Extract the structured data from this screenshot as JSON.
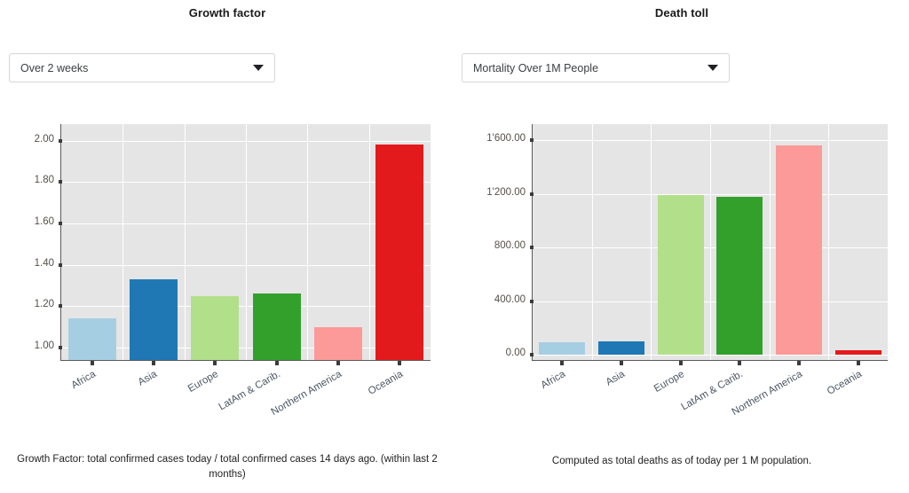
{
  "panels": [
    {
      "title": "Growth factor",
      "selector": {
        "value": "Over 2 weeks",
        "icon": "chevron-down-icon"
      },
      "caption": "Growth Factor: total confirmed cases today / total confirmed cases 14 days ago. (within last 2 months)",
      "chart_data": {
        "type": "bar",
        "title": "Growth factor",
        "xlabel": "",
        "ylabel": "",
        "categories": [
          "Africa",
          "Asia",
          "Europe",
          "LatAm & Carib.",
          "Northern America",
          "Oceania"
        ],
        "values": [
          1.14,
          1.33,
          1.25,
          1.26,
          1.1,
          1.98
        ],
        "colors": [
          "#a6cee3",
          "#1f78b4",
          "#b2df8a",
          "#33a02c",
          "#fb9a99",
          "#e31a1c"
        ],
        "ylim": [
          0.94,
          2.08
        ],
        "yticks": [
          1.0,
          1.2,
          1.4,
          1.6,
          1.8,
          2.0
        ],
        "ytick_labels": [
          "1.00",
          "1.20",
          "1.40",
          "1.60",
          "1.80",
          "2.00"
        ],
        "grid": true,
        "legend": "none",
        "plot_background": "#e5e5e5"
      }
    },
    {
      "title": "Death toll",
      "selector": {
        "value": "Mortality Over 1M People",
        "icon": "chevron-down-icon"
      },
      "caption": "Computed as total deaths as of today per 1 M population.",
      "chart_data": {
        "type": "bar",
        "title": "Death toll",
        "xlabel": "",
        "ylabel": "",
        "categories": [
          "Africa",
          "Asia",
          "Europe",
          "LatAm & Carib.",
          "Northern America",
          "Oceania"
        ],
        "values": [
          90,
          100,
          1190,
          1180,
          1560,
          30
        ],
        "colors": [
          "#a6cee3",
          "#1f78b4",
          "#b2df8a",
          "#33a02c",
          "#fb9a99",
          "#e31a1c"
        ],
        "ylim": [
          -40,
          1720
        ],
        "yticks": [
          0,
          400,
          800,
          1200,
          1600
        ],
        "ytick_labels": [
          "0.00",
          "400.00",
          "800.00",
          "1'200.00",
          "1'600.00"
        ],
        "grid": true,
        "legend": "none",
        "plot_background": "#e5e5e5"
      }
    }
  ]
}
